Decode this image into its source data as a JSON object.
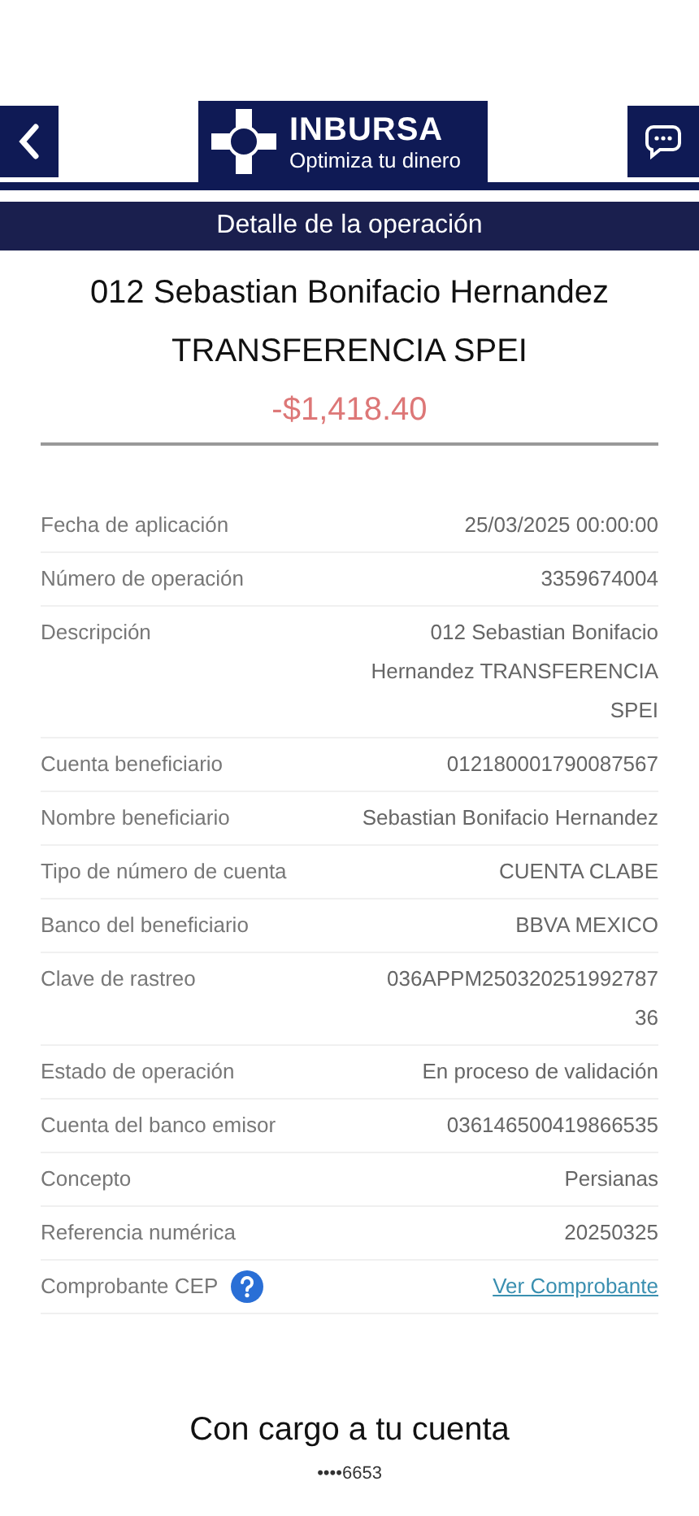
{
  "header": {
    "logo": {
      "name": "INBURSA",
      "tagline": "Optimiza tu dinero"
    }
  },
  "title_bar": {
    "title": "Detalle de la operación"
  },
  "summary": {
    "description_line_1": "012 Sebastian Bonifacio Hernandez",
    "description_line_2": "TRANSFERENCIA SPEI",
    "amount": "-$1,418.40"
  },
  "details": [
    {
      "label": "Fecha de aplicación",
      "value": "25/03/2025 00:00:00",
      "kind": "text"
    },
    {
      "label": "Número de operación",
      "value": "3359674004",
      "kind": "text"
    },
    {
      "label": "Descripción",
      "value": "012 Sebastian Bonifacio Hernandez TRANSFERENCIA SPEI",
      "kind": "text"
    },
    {
      "label": "Cuenta beneficiario",
      "value": "012180001790087567",
      "kind": "text"
    },
    {
      "label": "Nombre beneficiario",
      "value": "Sebastian Bonifacio Hernandez",
      "kind": "text"
    },
    {
      "label": "Tipo de número de cuenta",
      "value": "CUENTA CLABE",
      "kind": "text"
    },
    {
      "label": "Banco del beneficiario",
      "value": "BBVA MEXICO",
      "kind": "text"
    },
    {
      "label": "Clave de rastreo",
      "value": "036APPM25032025199278736",
      "kind": "text"
    },
    {
      "label": "Estado de operación",
      "value": "En proceso de validación",
      "kind": "text"
    },
    {
      "label": "Cuenta del banco emisor",
      "value": "036146500419866535",
      "kind": "text"
    },
    {
      "label": "Concepto",
      "value": "Persianas",
      "kind": "text"
    },
    {
      "label": "Referencia numérica",
      "value": "20250325",
      "kind": "text"
    },
    {
      "label": "Comprobante CEP",
      "value": "Ver Comprobante",
      "kind": "link"
    }
  ],
  "footer": {
    "caption": "Con cargo a tu cuenta",
    "account": "••••6653"
  }
}
